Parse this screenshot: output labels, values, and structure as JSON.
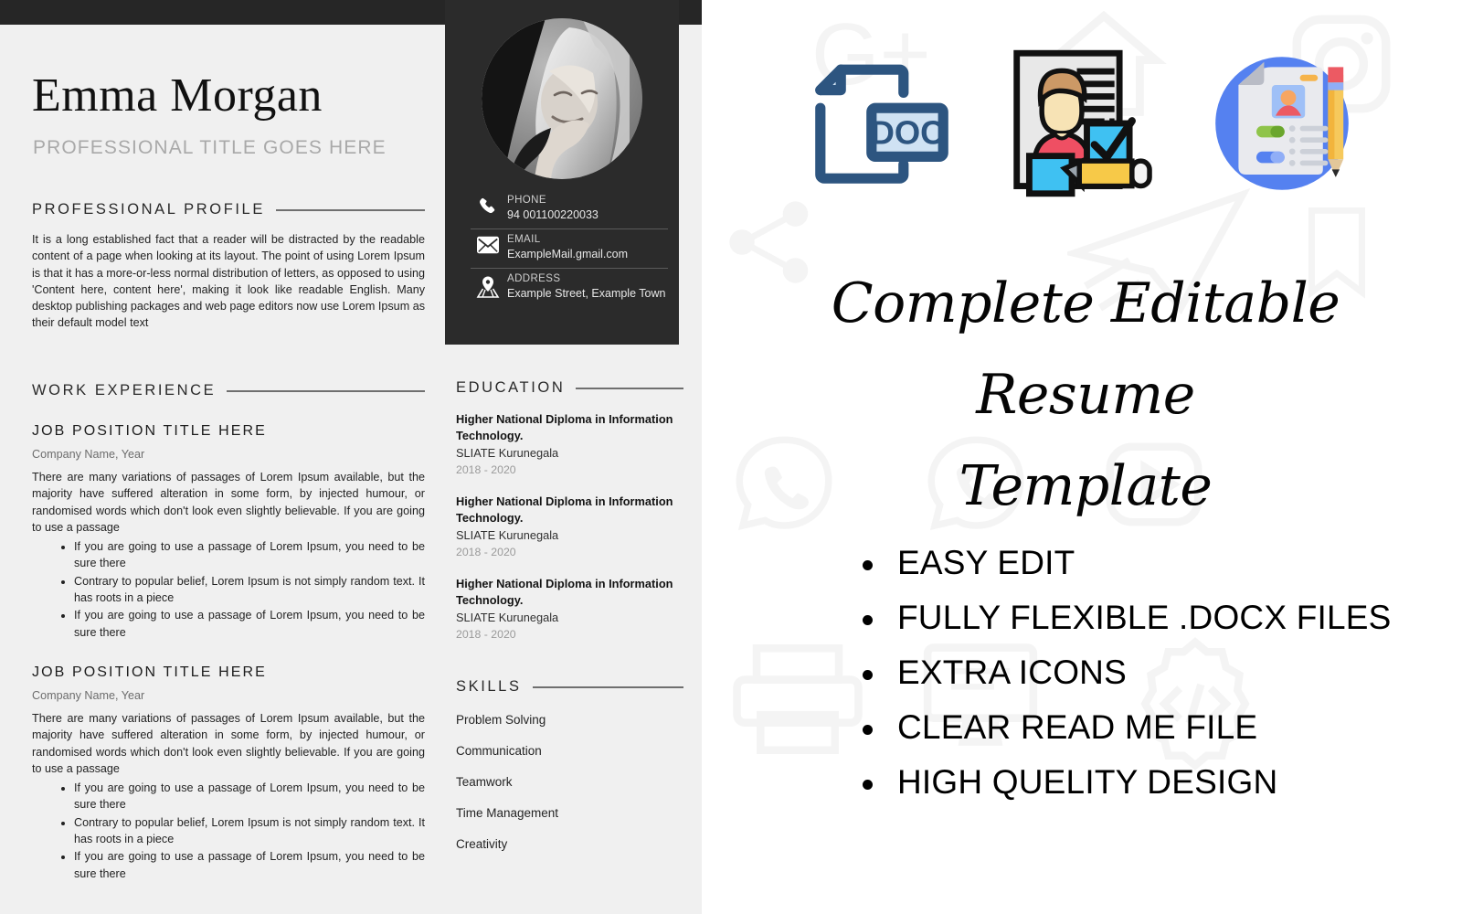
{
  "resume": {
    "name": "Emma Morgan",
    "subtitle": "PROFESSIONAL TITLE GOES HERE",
    "contact": {
      "phone": {
        "label": "PHONE",
        "value": "94 001100220033"
      },
      "email": {
        "label": "EMAIL",
        "value": "ExampleMail.gmail.com"
      },
      "address": {
        "label": "ADDRESS",
        "value": "Example Street, Example Town"
      }
    },
    "profile": {
      "heading": "PROFESSIONAL PROFILE",
      "body": "It is a long established fact that a reader will be distracted by the readable content of a page when looking at its layout. The point of using Lorem Ipsum is that it has a more-or-less normal distribution of letters, as opposed to using 'Content here, content here', making it look like readable English. Many desktop publishing packages and web page editors now use Lorem Ipsum as their default model text"
    },
    "work": {
      "heading": "WORK EXPERIENCE",
      "jobs": [
        {
          "title": "JOB POSITION TITLE HERE",
          "company": "Company Name, Year",
          "description": "There are many variations of passages of Lorem Ipsum available, but the majority have suffered alteration in some form, by injected humour, or randomised words which don't look even slightly believable. If you are going to use a passage",
          "bullets": [
            "If you are going to use a passage of Lorem Ipsum, you need to be sure there",
            "Contrary to popular belief, Lorem Ipsum is not simply random text. It has roots in a piece",
            "If you are going to use a passage of Lorem Ipsum, you need to be sure there"
          ]
        },
        {
          "title": "JOB POSITION TITLE HERE",
          "company": "Company Name, Year",
          "description": "There are many variations of passages of Lorem Ipsum available, but the majority have suffered alteration in some form, by injected humour, or randomised words which don't look even slightly believable. If you are going to use a passage",
          "bullets": [
            "If you are going to use a passage of Lorem Ipsum, you need to be sure there",
            "Contrary to popular belief, Lorem Ipsum is not simply random text. It has roots in a piece",
            "If you are going to use a passage of Lorem Ipsum, you need to be sure there"
          ]
        }
      ]
    },
    "education": {
      "heading": "EDUCATION",
      "items": [
        {
          "degree": "Higher National Diploma in Information Technology.",
          "school": "SLIATE Kurunegala",
          "years": "2018 - 2020"
        },
        {
          "degree": "Higher National Diploma in Information Technology.",
          "school": "SLIATE Kurunegala",
          "years": "2018 - 2020"
        },
        {
          "degree": "Higher National Diploma in Information Technology.",
          "school": "SLIATE Kurunegala",
          "years": "2018 - 2020"
        }
      ]
    },
    "skills": {
      "heading": "SKILLS",
      "items": [
        "Problem Solving",
        "Communication",
        "Teamwork",
        "Time Management",
        "Creativity"
      ]
    }
  },
  "promo": {
    "title_line1": "Complete Editable Resume",
    "title_line2": "Template",
    "features": [
      "EASY EDIT",
      "FULLY FLEXIBLE .DOCX FILES",
      "EXTRA ICONS",
      "CLEAR READ ME FILE",
      "HIGH QUELITY DESIGN"
    ],
    "icons": [
      {
        "name": "doc-file-icon",
        "label": "DOC"
      },
      {
        "name": "resume-checklist-icon",
        "label": ""
      },
      {
        "name": "resume-pencil-circle-icon",
        "label": ""
      }
    ],
    "watermark_icons": [
      "google-plus-icon",
      "home-icon",
      "instagram-icon",
      "share-icon",
      "paper-plane-icon",
      "whatsapp-icon",
      "whatsapp-icon",
      "youtube-icon",
      "printer-icon",
      "monitor-icon",
      "gear-code-icon"
    ]
  },
  "colors": {
    "dark_panel": "#2b2b2b",
    "page_bg": "#f0f0f0",
    "rule": "#6f6f6f",
    "muted_text": "#9a9a9a",
    "doc_icon_blue": "#2d5580",
    "doc_icon_light": "#cfe2f3"
  }
}
